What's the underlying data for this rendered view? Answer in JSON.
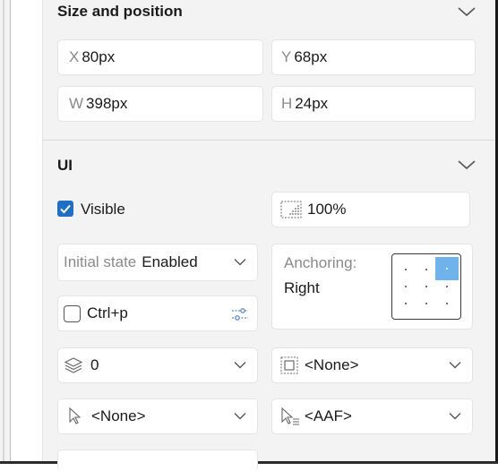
{
  "size_position": {
    "title": "Size and position",
    "x": {
      "prefix": "X",
      "value": "80px"
    },
    "y": {
      "prefix": "Y",
      "value": "68px"
    },
    "w": {
      "prefix": "W",
      "value": "398px"
    },
    "h": {
      "prefix": "H",
      "value": "24px"
    }
  },
  "ui": {
    "title": "UI",
    "visible_label": "Visible",
    "visible_checked": true,
    "opacity": "100%",
    "initial_state_label": "Initial state",
    "initial_state_value": "Enabled",
    "anchoring_label": "Anchoring:",
    "anchoring_value": "Right",
    "shortcut": "Ctrl+p",
    "zindex": "0",
    "border_value": "<None>",
    "cursor_value": "<None>",
    "hover_cursor_value": "<AAF>"
  },
  "icons": {
    "collapse": "chevron-up-icon",
    "expand": "chevron-down-icon",
    "opacity": "opacity-icon",
    "settings": "sliders-icon",
    "layers": "layers-icon",
    "border": "border-frame-icon",
    "cursor": "cursor-icon",
    "cursor_text": "cursor-text-icon"
  },
  "colors": {
    "panel_bg": "#f3f3f3",
    "accent": "#1f6fc5",
    "anchor_selected": "#6fb3ec"
  }
}
